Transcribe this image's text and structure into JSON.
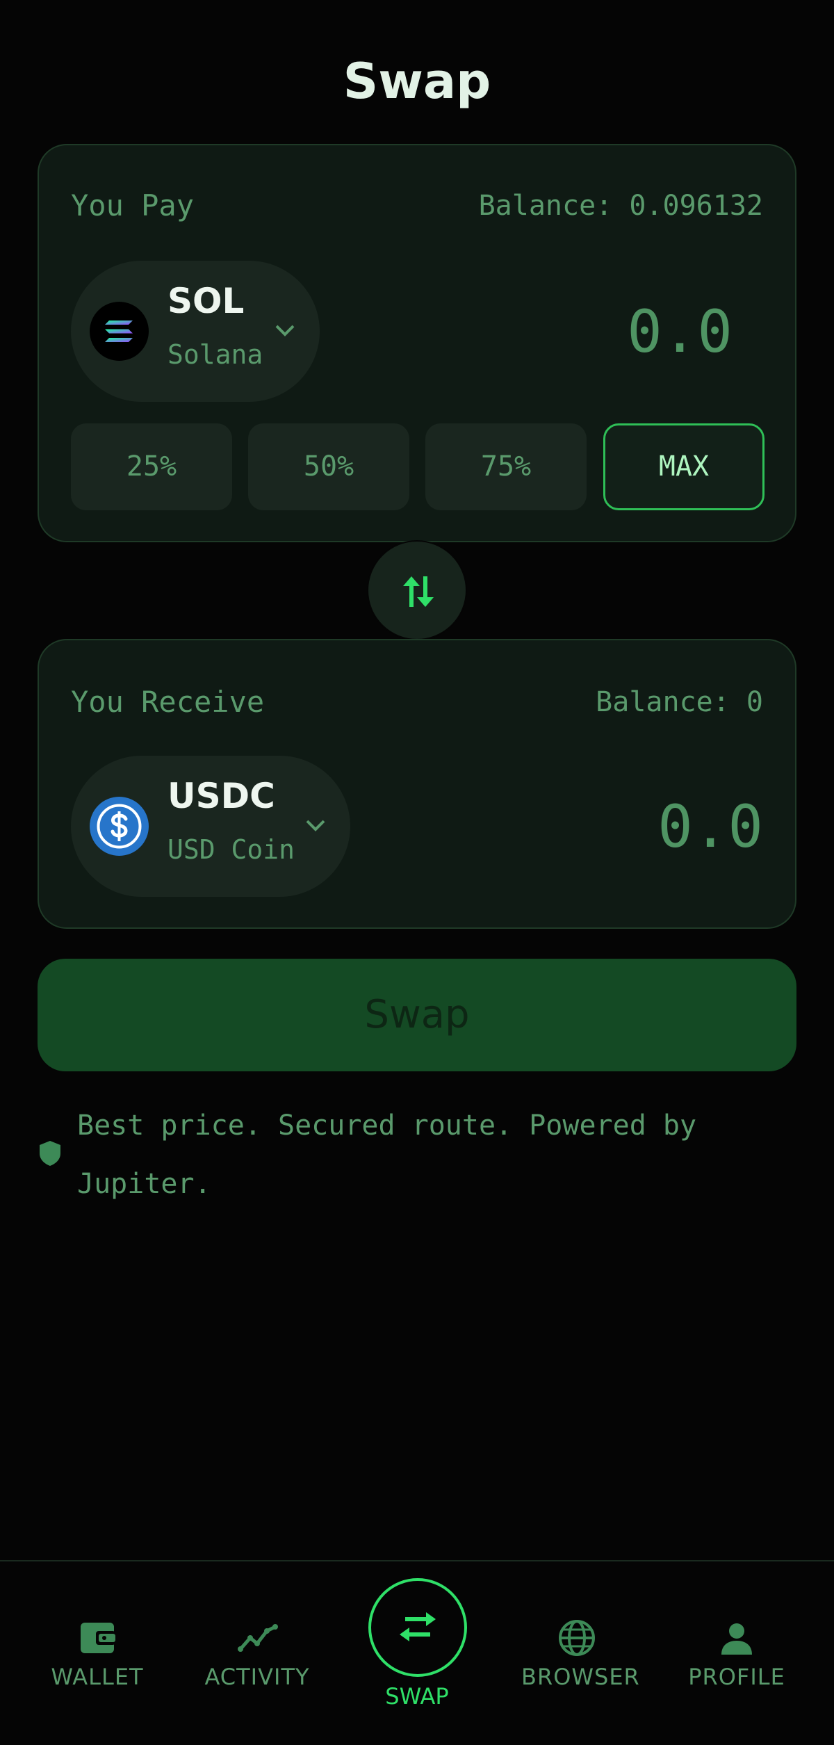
{
  "header": {
    "title": "Swap"
  },
  "pay": {
    "label": "You Pay",
    "balance": "Balance: 0.096132",
    "token_symbol": "SOL",
    "token_name": "Solana",
    "amount": "0.0",
    "percent_buttons": [
      "25%",
      "50%",
      "75%",
      "MAX"
    ],
    "selected_percent": "MAX"
  },
  "receive": {
    "label": "You Receive",
    "balance": "Balance: 0",
    "token_symbol": "USDC",
    "token_name": "USD Coin",
    "amount": "0.0"
  },
  "swap_button_label": "Swap",
  "note": "Best price. Secured route. Powered by Jupiter.",
  "nav": {
    "items": [
      {
        "label": "WALLET",
        "icon": "wallet-icon"
      },
      {
        "label": "ACTIVITY",
        "icon": "activity-icon"
      },
      {
        "label": "SWAP",
        "icon": "swap-icon",
        "active": true
      },
      {
        "label": "BROWSER",
        "icon": "globe-icon"
      },
      {
        "label": "PROFILE",
        "icon": "person-icon"
      }
    ]
  },
  "colors": {
    "background": "#050505",
    "card": "#0f1a14",
    "accent": "#2fe068",
    "muted_text": "#5a9a6c",
    "swap_button": "#144a24",
    "usdc_blue": "#2775ca"
  }
}
